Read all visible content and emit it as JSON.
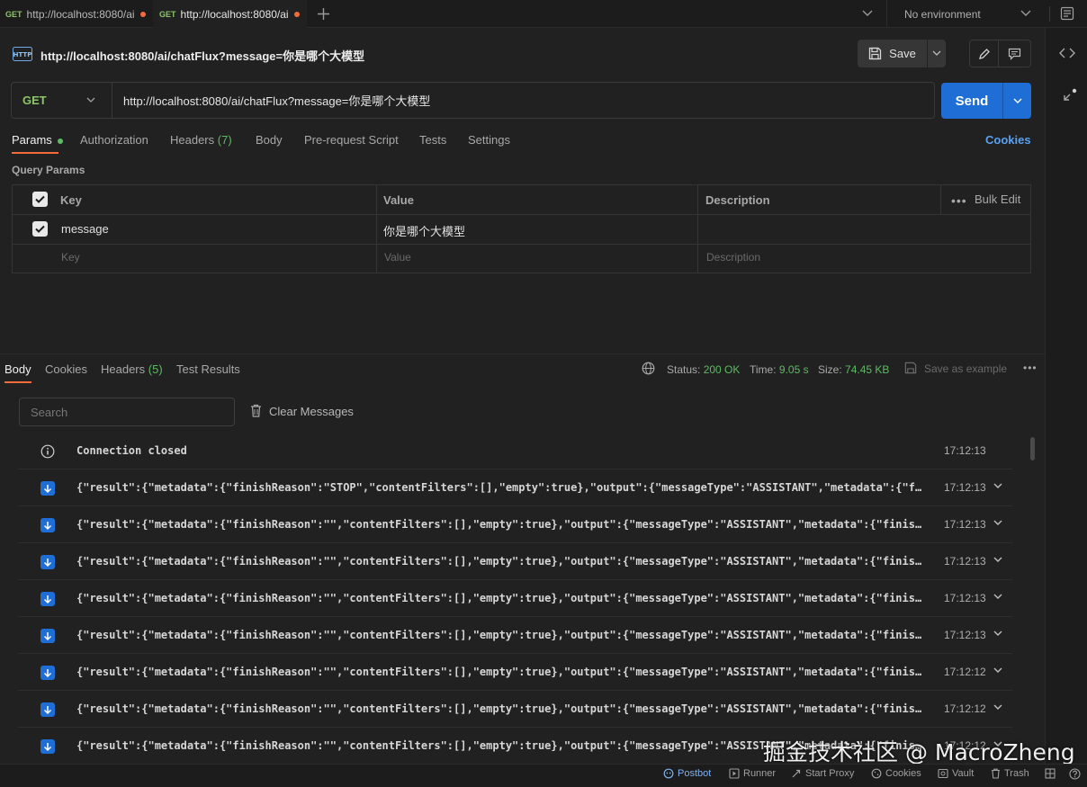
{
  "tabs": [
    {
      "method": "GET",
      "title": "http://localhost:8080/ai",
      "unsaved": true
    },
    {
      "method": "GET",
      "title": "http://localhost:8080/ai",
      "unsaved": true,
      "active": true
    }
  ],
  "environment": {
    "selected": "No environment"
  },
  "request": {
    "name": "http://localhost:8080/ai/chatFlux?message=你是哪个大模型",
    "method": "GET",
    "url": "http://localhost:8080/ai/chatFlux?message=你是哪个大模型",
    "save_label": "Save",
    "send_label": "Send",
    "tabs": {
      "params": "Params",
      "authorization": "Authorization",
      "headers": "Headers",
      "headers_count": "(7)",
      "body": "Body",
      "pre_request": "Pre-request Script",
      "tests": "Tests",
      "settings": "Settings"
    },
    "cookies_link": "Cookies",
    "query_params_title": "Query Params",
    "table": {
      "headers": {
        "key": "Key",
        "value": "Value",
        "description": "Description",
        "bulk_edit": "Bulk Edit"
      },
      "rows": [
        {
          "key": "message",
          "value": "你是哪个大模型",
          "description": "",
          "checked": true
        }
      ],
      "placeholders": {
        "key": "Key",
        "value": "Value",
        "description": "Description"
      }
    }
  },
  "response": {
    "tabs": {
      "body": "Body",
      "cookies": "Cookies",
      "headers": "Headers",
      "headers_count": "(5)",
      "test_results": "Test Results"
    },
    "status_label": "Status:",
    "status": "200 OK",
    "time_label": "Time:",
    "time": "9.05 s",
    "size_label": "Size:",
    "size": "74.45 KB",
    "save_example": "Save as example",
    "search_placeholder": "Search",
    "clear_messages": "Clear Messages",
    "connection": {
      "text": "Connection closed",
      "time": "17:12:13"
    },
    "messages": [
      {
        "text": "{\"result\":{\"metadata\":{\"finishReason\":\"STOP\",\"contentFilters\":[],\"empty\":true},\"output\":{\"messageType\":\"ASSISTANT\",\"metadata\":{\"finishReason\":\"STOP\"}}}}",
        "time": "17:12:13"
      },
      {
        "text": "{\"result\":{\"metadata\":{\"finishReason\":\"\",\"contentFilters\":[],\"empty\":true},\"output\":{\"messageType\":\"ASSISTANT\",\"metadata\":{\"finishReason\":\"\"}}}}",
        "time": "17:12:13"
      },
      {
        "text": "{\"result\":{\"metadata\":{\"finishReason\":\"\",\"contentFilters\":[],\"empty\":true},\"output\":{\"messageType\":\"ASSISTANT\",\"metadata\":{\"finishReason\":\"\"}}}}",
        "time": "17:12:13"
      },
      {
        "text": "{\"result\":{\"metadata\":{\"finishReason\":\"\",\"contentFilters\":[],\"empty\":true},\"output\":{\"messageType\":\"ASSISTANT\",\"metadata\":{\"finishReason\":\"\"}}}}",
        "time": "17:12:13"
      },
      {
        "text": "{\"result\":{\"metadata\":{\"finishReason\":\"\",\"contentFilters\":[],\"empty\":true},\"output\":{\"messageType\":\"ASSISTANT\",\"metadata\":{\"finishReason\":\"\"}}}}",
        "time": "17:12:13"
      },
      {
        "text": "{\"result\":{\"metadata\":{\"finishReason\":\"\",\"contentFilters\":[],\"empty\":true},\"output\":{\"messageType\":\"ASSISTANT\",\"metadata\":{\"finishReason\":\"\"}}}}",
        "time": "17:12:12"
      },
      {
        "text": "{\"result\":{\"metadata\":{\"finishReason\":\"\",\"contentFilters\":[],\"empty\":true},\"output\":{\"messageType\":\"ASSISTANT\",\"metadata\":{\"finishReason\":\"\"}}}}",
        "time": "17:12:12"
      },
      {
        "text": "{\"result\":{\"metadata\":{\"finishReason\":\"\",\"contentFilters\":[],\"empty\":true},\"output\":{\"messageType\":\"ASSISTANT\",\"metadata\":{\"finishReason\":\"\"}}}}",
        "time": "17:12:12"
      }
    ]
  },
  "statusbar": {
    "postbot": "Postbot",
    "runner": "Runner",
    "start_proxy": "Start Proxy",
    "cookies": "Cookies",
    "vault": "Vault",
    "trash": "Trash"
  },
  "watermark": "掘金技术社区 @ MacroZheng",
  "colors": {
    "accent": "#1e6ed6",
    "get": "#8cc56a",
    "success": "#5dbb63",
    "unsaved": "#f26b3a",
    "link": "#5aa0f0"
  }
}
